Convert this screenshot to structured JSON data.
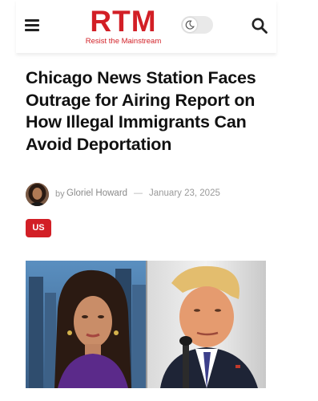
{
  "header": {
    "logo_text": "RTM",
    "logo_tagline": "Resist the Mainstream"
  },
  "article": {
    "title": "Chicago News Station Faces Outrage for Airing Report on How Illegal Immigrants Can Avoid Deportation",
    "by_prefix": "by",
    "author": "Gloriel Howard",
    "separator": "—",
    "date": "January 23, 2025",
    "category": "US"
  },
  "icons": {
    "menu": "hamburger-menu-icon",
    "dark_mode": "moon-icon",
    "search": "search-icon"
  },
  "colors": {
    "brand": "#d21f26",
    "title": "#111111",
    "meta": "#9a9a9a"
  }
}
